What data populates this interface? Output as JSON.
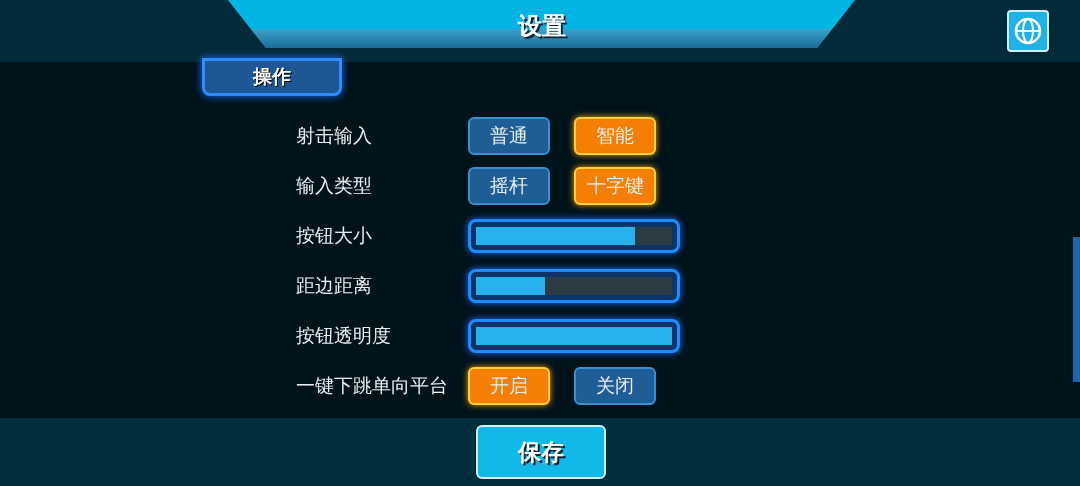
{
  "header": {
    "title": "设置"
  },
  "section_tab": {
    "label": "操作"
  },
  "settings": [
    {
      "kind": "choice",
      "label": "射击输入",
      "options": [
        {
          "label": "普通",
          "selected": false
        },
        {
          "label": "智能",
          "selected": true
        }
      ]
    },
    {
      "kind": "choice",
      "label": "输入类型",
      "options": [
        {
          "label": "摇杆",
          "selected": false
        },
        {
          "label": "十字键",
          "selected": true
        }
      ]
    },
    {
      "kind": "slider",
      "label": "按钮大小",
      "level": 0.81
    },
    {
      "kind": "slider",
      "label": "距边距离",
      "level": 0.35
    },
    {
      "kind": "slider",
      "label": "按钮透明度",
      "level": 1.0
    },
    {
      "kind": "choice",
      "label": "一键下跳单向平台",
      "options": [
        {
          "label": "开启",
          "selected": true
        },
        {
          "label": "关闭",
          "selected": false
        }
      ]
    }
  ],
  "footer": {
    "save_button": "保存"
  }
}
